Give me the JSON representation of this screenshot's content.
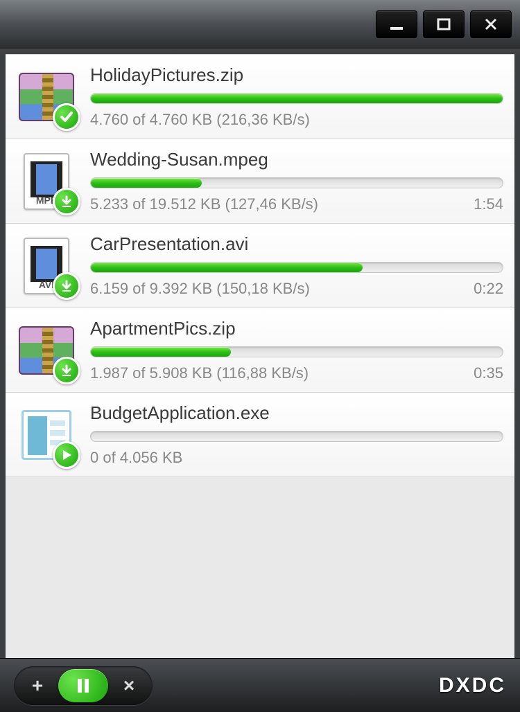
{
  "brand": "DXDC",
  "downloads": [
    {
      "filename": "HolidayPictures.zip",
      "type": "archive",
      "state": "complete",
      "progress": 100,
      "status": "4.760 of 4.760 KB (216,36 KB/s)",
      "eta": ""
    },
    {
      "filename": "Wedding-Susan.mpeg",
      "type": "video",
      "ext": "MPE",
      "state": "downloading",
      "progress": 27,
      "status": "5.233 of 19.512 KB (127,46 KB/s)",
      "eta": "1:54"
    },
    {
      "filename": "CarPresentation.avi",
      "type": "video",
      "ext": "AVI",
      "state": "downloading",
      "progress": 66,
      "status": "6.159 of 9.392 KB (150,18 KB/s)",
      "eta": "0:22"
    },
    {
      "filename": "ApartmentPics.zip",
      "type": "archive",
      "state": "downloading",
      "progress": 34,
      "status": "1.987 of 5.908 KB (116,88 KB/s)",
      "eta": "0:35"
    },
    {
      "filename": "BudgetApplication.exe",
      "type": "exe",
      "state": "queued",
      "progress": 0,
      "status": "0 of 4.056 KB",
      "eta": ""
    }
  ]
}
